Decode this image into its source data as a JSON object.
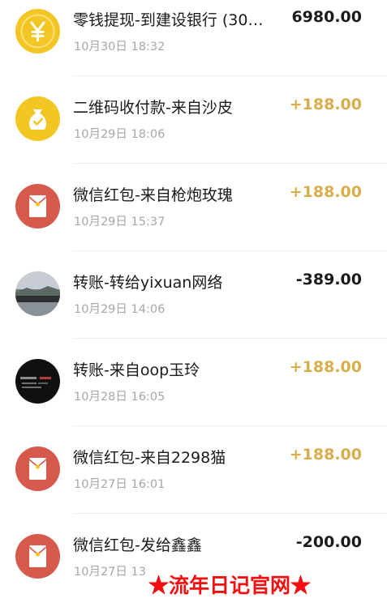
{
  "transactions": [
    {
      "title": "零钱提现-到建设银行 (30…",
      "time": "10月30日 18:32",
      "amount": "6980.00",
      "direction": "out",
      "icon": "yuan-coin-icon"
    },
    {
      "title": "二维码收付款-来自沙皮",
      "time": "10月29日 18:06",
      "amount": "+188.00",
      "direction": "in",
      "icon": "money-bag-icon"
    },
    {
      "title": "微信红包-来自枪炮玫瑰",
      "time": "10月29日 15:37",
      "amount": "+188.00",
      "direction": "in",
      "icon": "red-packet-icon"
    },
    {
      "title": "转账-转给yixuan网络",
      "time": "10月29日 14:06",
      "amount": "-389.00",
      "direction": "out",
      "icon": "user-avatar"
    },
    {
      "title": "转账-来自oop玉玲",
      "time": "10月28日 16:05",
      "amount": "+188.00",
      "direction": "in",
      "icon": "user-avatar"
    },
    {
      "title": "微信红包-来自2298猫",
      "time": "10月27日 16:01",
      "amount": "+188.00",
      "direction": "in",
      "icon": "red-packet-icon"
    },
    {
      "title": "微信红包-发给鑫鑫",
      "time": "10月27日 13",
      "amount": "-200.00",
      "direction": "out",
      "icon": "red-packet-icon"
    }
  ],
  "watermark": "★流年日记官网★",
  "colors": {
    "income": "#d8ae4c",
    "expense": "#1b1b1b",
    "coin": "#f3c623",
    "red_packet": "#d55a4c"
  }
}
